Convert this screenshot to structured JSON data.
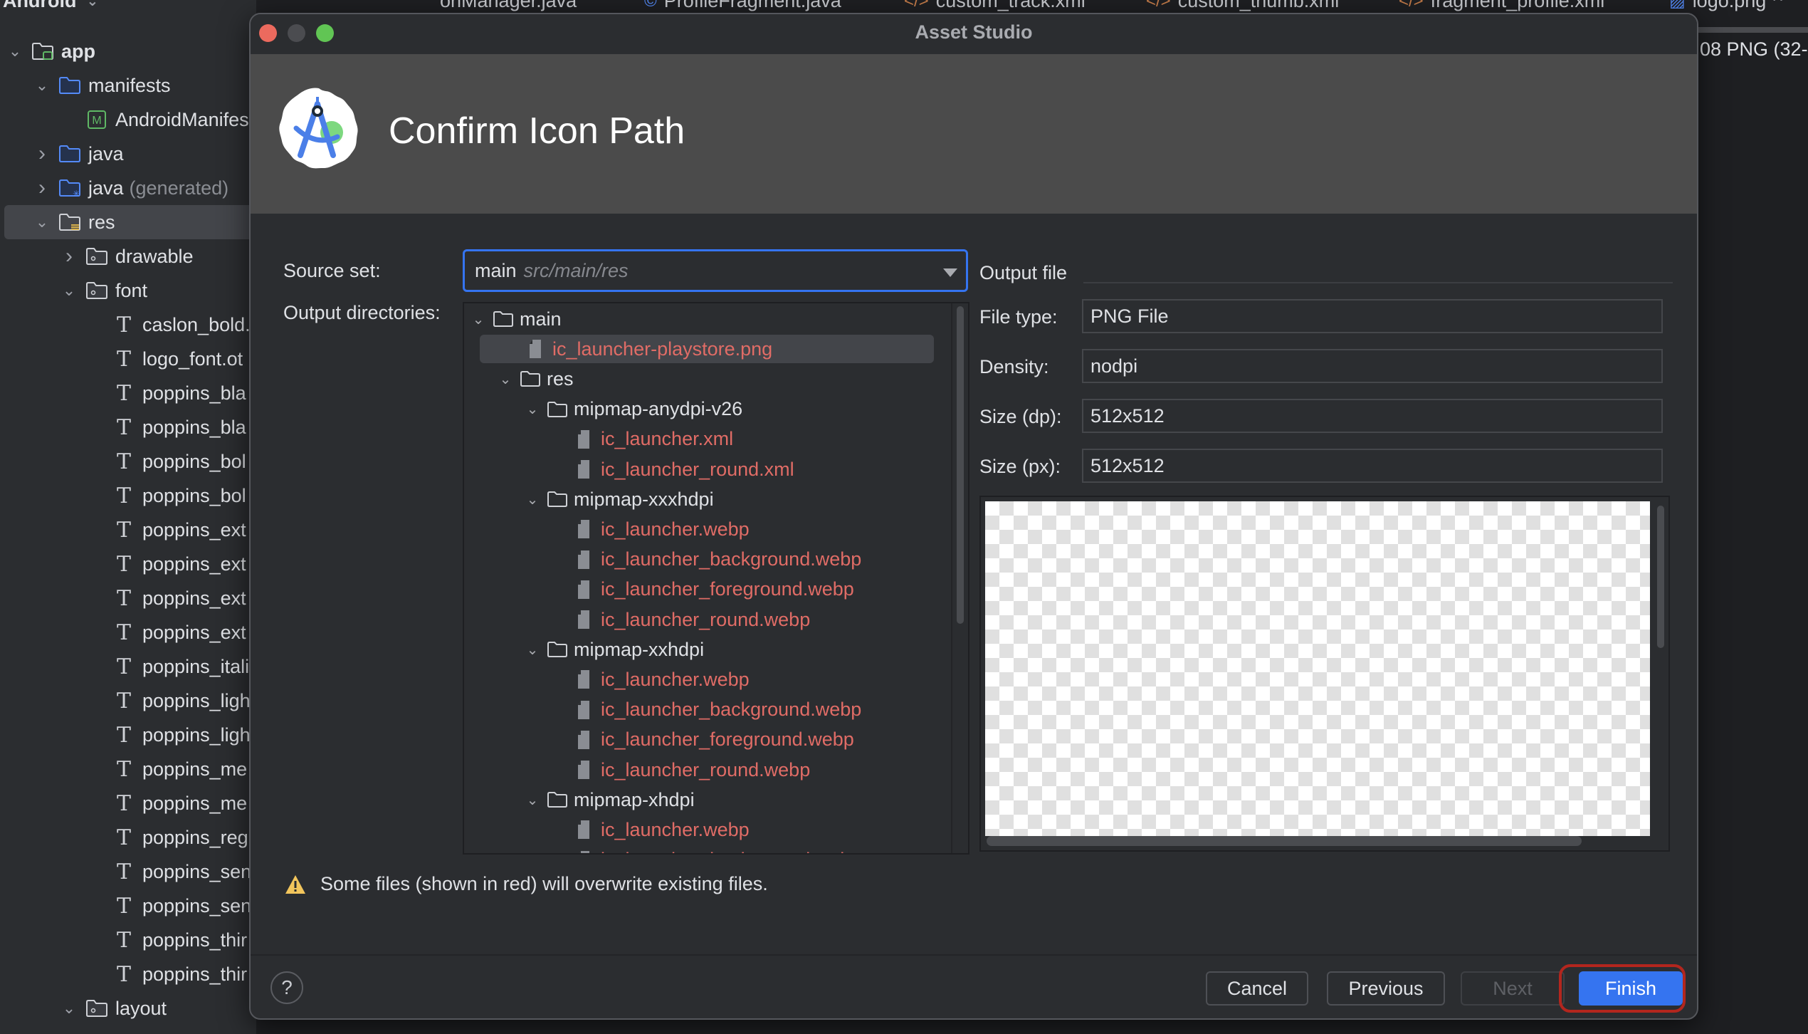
{
  "ide": {
    "project_view_label": "Android",
    "tree": [
      {
        "label": "app",
        "depth": 0,
        "expanded": true,
        "icon": "module-folder-icon",
        "bold": true
      },
      {
        "label": "manifests",
        "depth": 1,
        "expanded": true,
        "icon": "source-folder-icon"
      },
      {
        "label": "AndroidManifest.xml",
        "depth": 2,
        "icon": "manifest-icon"
      },
      {
        "label": "java",
        "depth": 1,
        "expanded": false,
        "icon": "source-folder-icon"
      },
      {
        "label": "java",
        "suffix": "(generated)",
        "depth": 1,
        "expanded": false,
        "icon": "generated-folder-icon"
      },
      {
        "label": "res",
        "depth": 1,
        "expanded": true,
        "icon": "resource-folder-icon",
        "selected": true
      },
      {
        "label": "drawable",
        "depth": 2,
        "expanded": false,
        "icon": "package-folder-icon"
      },
      {
        "label": "font",
        "depth": 2,
        "expanded": true,
        "icon": "package-folder-icon"
      },
      {
        "label": "caslon_bold.",
        "depth": 3,
        "icon": "font-file-icon"
      },
      {
        "label": "logo_font.ot",
        "depth": 3,
        "icon": "font-file-icon"
      },
      {
        "label": "poppins_bla",
        "depth": 3,
        "icon": "font-file-icon"
      },
      {
        "label": "poppins_bla",
        "depth": 3,
        "icon": "font-file-icon"
      },
      {
        "label": "poppins_bol",
        "depth": 3,
        "icon": "font-file-icon"
      },
      {
        "label": "poppins_bol",
        "depth": 3,
        "icon": "font-file-icon"
      },
      {
        "label": "poppins_ext",
        "depth": 3,
        "icon": "font-file-icon"
      },
      {
        "label": "poppins_ext",
        "depth": 3,
        "icon": "font-file-icon"
      },
      {
        "label": "poppins_ext",
        "depth": 3,
        "icon": "font-file-icon"
      },
      {
        "label": "poppins_ext",
        "depth": 3,
        "icon": "font-file-icon"
      },
      {
        "label": "poppins_itali",
        "depth": 3,
        "icon": "font-file-icon"
      },
      {
        "label": "poppins_ligh",
        "depth": 3,
        "icon": "font-file-icon"
      },
      {
        "label": "poppins_ligh",
        "depth": 3,
        "icon": "font-file-icon"
      },
      {
        "label": "poppins_me",
        "depth": 3,
        "icon": "font-file-icon"
      },
      {
        "label": "poppins_me",
        "depth": 3,
        "icon": "font-file-icon"
      },
      {
        "label": "poppins_reg",
        "depth": 3,
        "icon": "font-file-icon"
      },
      {
        "label": "poppins_sen",
        "depth": 3,
        "icon": "font-file-icon"
      },
      {
        "label": "poppins_sen",
        "depth": 3,
        "icon": "font-file-icon"
      },
      {
        "label": "poppins_thir",
        "depth": 3,
        "icon": "font-file-icon"
      },
      {
        "label": "poppins_thir",
        "depth": 3,
        "icon": "font-file-icon"
      },
      {
        "label": "layout",
        "depth": 2,
        "expanded": true,
        "icon": "package-folder-icon"
      }
    ],
    "editor_tabs": [
      {
        "label": "onManager.java",
        "icon": "none"
      },
      {
        "label": "ProfileFragment.java",
        "icon": "class-icon"
      },
      {
        "label": "custom_track.xml",
        "icon": "xml-icon"
      },
      {
        "label": "custom_thumb.xml",
        "icon": "xml-icon"
      },
      {
        "label": "fragment_profile.xml",
        "icon": "xml-icon"
      },
      {
        "label": "logo.png",
        "icon": "image-icon"
      }
    ],
    "editor_info": "08 PNG (32-"
  },
  "dialog": {
    "window_title": "Asset Studio",
    "heading": "Confirm Icon Path",
    "source_set_label": "Source set:",
    "source_set_value": "main",
    "source_set_path": "src/main/res",
    "output_dirs_label": "Output directories:",
    "output_tree": [
      {
        "label": "main",
        "type": "folder",
        "depth": 0,
        "expanded": true
      },
      {
        "label": "ic_launcher-playstore.png",
        "type": "file",
        "depth": 1,
        "overwrite": true,
        "selected": true
      },
      {
        "label": "res",
        "type": "folder",
        "depth": 1,
        "expanded": true
      },
      {
        "label": "mipmap-anydpi-v26",
        "type": "folder",
        "depth": 2,
        "expanded": true
      },
      {
        "label": "ic_launcher.xml",
        "type": "file",
        "depth": 3,
        "overwrite": true
      },
      {
        "label": "ic_launcher_round.xml",
        "type": "file",
        "depth": 3,
        "overwrite": true
      },
      {
        "label": "mipmap-xxxhdpi",
        "type": "folder",
        "depth": 2,
        "expanded": true
      },
      {
        "label": "ic_launcher.webp",
        "type": "file",
        "depth": 3,
        "overwrite": true
      },
      {
        "label": "ic_launcher_background.webp",
        "type": "file",
        "depth": 3,
        "overwrite": true
      },
      {
        "label": "ic_launcher_foreground.webp",
        "type": "file",
        "depth": 3,
        "overwrite": true
      },
      {
        "label": "ic_launcher_round.webp",
        "type": "file",
        "depth": 3,
        "overwrite": true
      },
      {
        "label": "mipmap-xxhdpi",
        "type": "folder",
        "depth": 2,
        "expanded": true
      },
      {
        "label": "ic_launcher.webp",
        "type": "file",
        "depth": 3,
        "overwrite": true
      },
      {
        "label": "ic_launcher_background.webp",
        "type": "file",
        "depth": 3,
        "overwrite": true
      },
      {
        "label": "ic_launcher_foreground.webp",
        "type": "file",
        "depth": 3,
        "overwrite": true
      },
      {
        "label": "ic_launcher_round.webp",
        "type": "file",
        "depth": 3,
        "overwrite": true
      },
      {
        "label": "mipmap-xhdpi",
        "type": "folder",
        "depth": 2,
        "expanded": true
      },
      {
        "label": "ic_launcher.webp",
        "type": "file",
        "depth": 3,
        "overwrite": true
      },
      {
        "label": "ic_launcher_background.webp",
        "type": "file",
        "depth": 3,
        "overwrite": true
      }
    ],
    "output_file": {
      "heading": "Output file",
      "file_type_label": "File type:",
      "file_type": "PNG File",
      "density_label": "Density:",
      "density": "nodpi",
      "size_dp_label": "Size (dp):",
      "size_dp": "512x512",
      "size_px_label": "Size (px):",
      "size_px": "512x512"
    },
    "warning": "Some files (shown in red) will overwrite existing files.",
    "help_label": "?",
    "buttons": {
      "cancel": "Cancel",
      "previous": "Previous",
      "next": "Next",
      "finish": "Finish"
    },
    "colors": {
      "accent": "#3574f0",
      "overwrite_red": "#e06c66",
      "highlight_ring": "#b3261e",
      "warning_yellow": "#f2c55c"
    }
  }
}
